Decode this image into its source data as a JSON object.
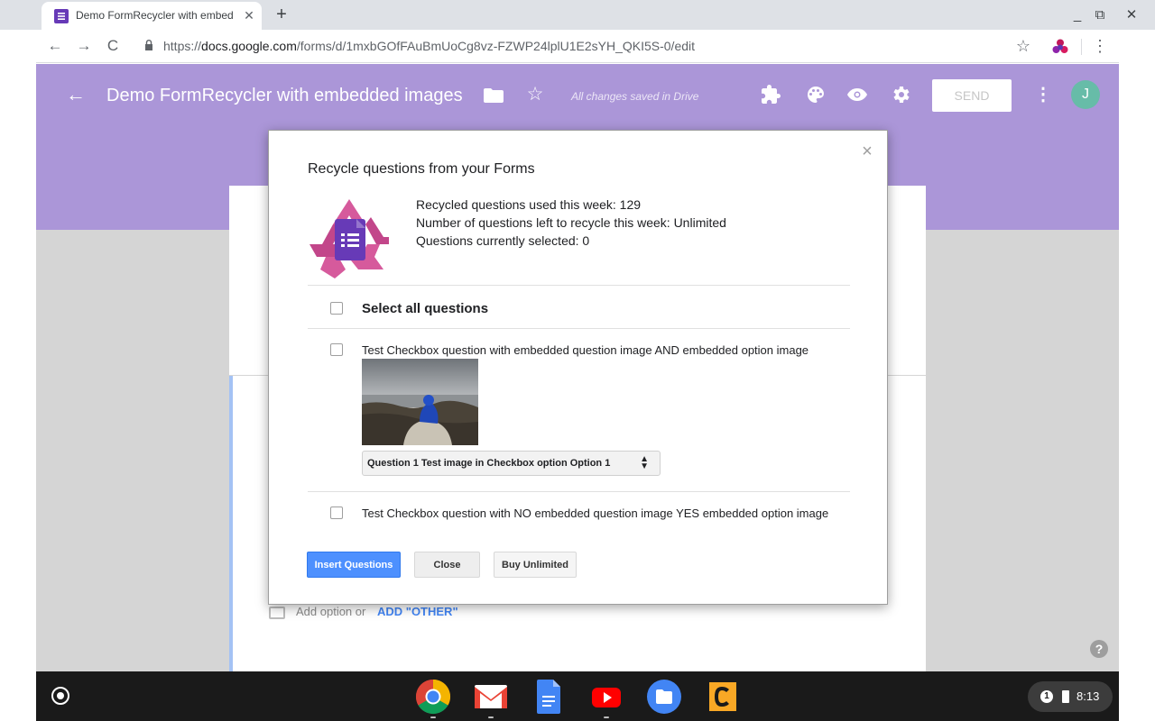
{
  "browser": {
    "tab_title": "Demo FormRecycler with embed",
    "tab_close": "✕",
    "new_tab": "+",
    "window_minimize": "_",
    "window_restore": "⧉",
    "window_close": "✕",
    "back": "←",
    "forward": "→",
    "reload": "C",
    "url_scheme": "https://",
    "url_host": "docs.google.com",
    "url_path": "/forms/d/1mxbGOfFAuBmUoCg8vz-FZWP24lplU1E2sYH_QKI5S-0/edit",
    "bookmark_star": "☆",
    "menu": "⋮"
  },
  "form_header": {
    "back": "←",
    "title": "Demo FormRecycler with embedded images",
    "star": "☆",
    "saved_status": "All changes saved in Drive",
    "send_label": "SEND",
    "more": "⋮",
    "avatar_initial": "J",
    "accent_color": "#ab96d8"
  },
  "form_body": {
    "add_option": "Add option",
    "or_text": "or",
    "add_other": "ADD \"OTHER\"",
    "help": "?"
  },
  "modal": {
    "close": "×",
    "title": "Recycle questions from your Forms",
    "stats": {
      "used": "Recycled questions used this week: 129",
      "left": "Number of questions left to recycle this week: Unlimited",
      "selected": "Questions currently selected: 0"
    },
    "select_all_label": "Select all questions",
    "questions": [
      {
        "label": "Test Checkbox question with embedded question image AND embedded option image",
        "option_select": "Question 1 Test image in Checkbox option Option 1"
      },
      {
        "label": "Test Checkbox question with NO embedded question image YES embedded option image"
      }
    ],
    "buttons": {
      "insert": "Insert Questions",
      "close": "Close",
      "buy": "Buy Unlimited"
    }
  },
  "shelf": {
    "apps": [
      "chrome-icon",
      "gmail-icon",
      "docs-icon",
      "youtube-icon",
      "files-icon",
      "c-app-icon"
    ],
    "notification_count": "1",
    "clock": "8:13"
  }
}
